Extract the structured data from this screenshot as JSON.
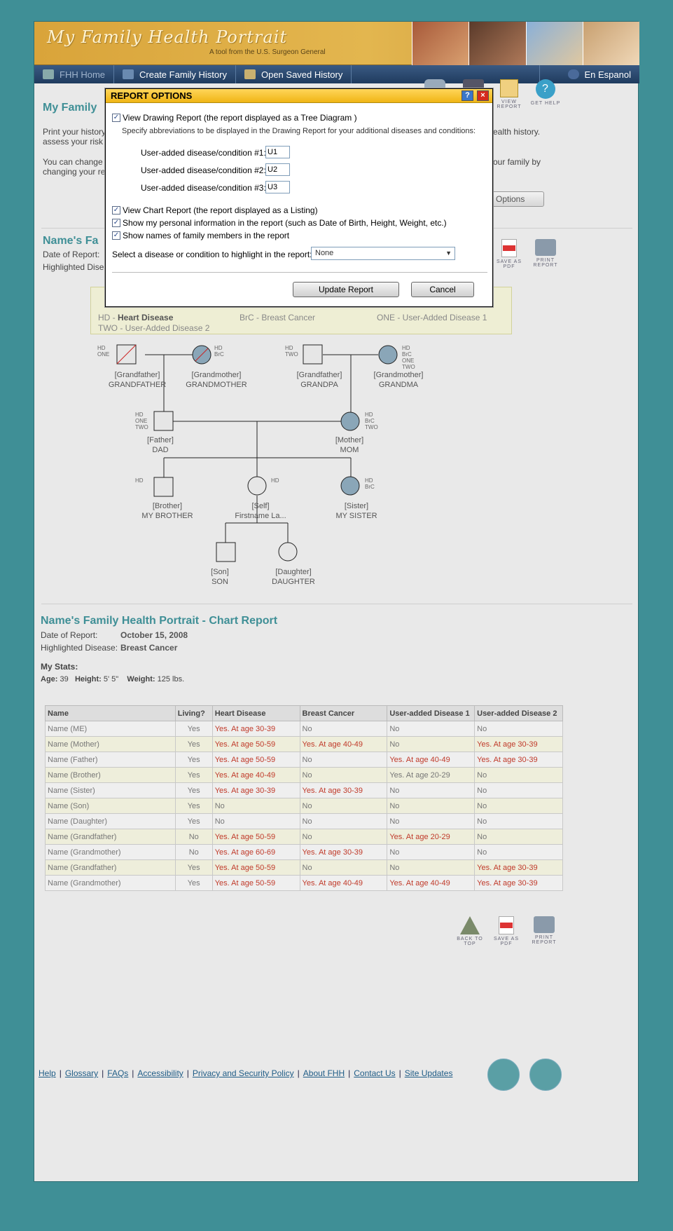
{
  "banner": {
    "title": "My Family Health Portrait",
    "subtitle": "A tool from the U.S. Surgeon General"
  },
  "nav": {
    "items": [
      {
        "label": "FHH Home",
        "icon": "home-icon"
      },
      {
        "label": "Create Family History",
        "icon": "plus-icon"
      },
      {
        "label": "Open Saved History",
        "icon": "folder-icon"
      }
    ],
    "language": "En Espanol"
  },
  "header_icons": {
    "view_report": "VIEW REPORT",
    "get_help": "GET HELP"
  },
  "intro": {
    "title_partial": "My Family",
    "line1": "Print your history",
    "line2": "assess your risk",
    "line1_right": "ealth history.",
    "line3": "You can change t",
    "line4": "changing your rep",
    "line3_right": "our family by",
    "options_btn": "Options"
  },
  "drawing": {
    "title_partial": "Name's Fa",
    "date_label": "Date of Report:",
    "highlight_label": "Highlighted Disea",
    "save_pdf": "SAVE AS PDF",
    "print": "PRINT REPORT",
    "legend": {
      "hd": "HD - ",
      "hd_name": "Heart Disease",
      "brc": "BrC - Breast Cancer",
      "one": "ONE - User-Added Disease 1",
      "two": "TWO - User-Added Disease 2"
    },
    "people": {
      "gf1": {
        "role": "[Grandfather]",
        "name": "GRANDFATHER",
        "codes": "HD\nONE"
      },
      "gm1": {
        "role": "[Grandmother]",
        "name": "GRANDMOTHER",
        "codes": "HD\nBrC"
      },
      "gf2": {
        "role": "[Grandfather]",
        "name": "GRANDPA",
        "codes": "HD\nTWO"
      },
      "gm2": {
        "role": "[Grandmother]",
        "name": "GRANDMA",
        "codes": "HD\nBrC\nONE\nTWO"
      },
      "father": {
        "role": "[Father]",
        "name": "DAD",
        "codes": "HD\nONE\nTWO"
      },
      "mother": {
        "role": "[Mother]",
        "name": "MOM",
        "codes": "HD\nBrC\nTWO"
      },
      "brother": {
        "role": "[Brother]",
        "name": "MY BROTHER",
        "codes": "HD"
      },
      "self": {
        "role": "[Self]",
        "name": "Firstname La...",
        "codes": "HD"
      },
      "sister": {
        "role": "[Sister]",
        "name": "MY SISTER",
        "codes": "HD\nBrC"
      },
      "son": {
        "role": "[Son]",
        "name": "SON"
      },
      "daughter": {
        "role": "[Daughter]",
        "name": "DAUGHTER"
      }
    }
  },
  "chart": {
    "title": "Name's Family Health Portrait - Chart Report",
    "date_label": "Date of Report:",
    "date_value": "October 15, 2008",
    "highlight_label": "Highlighted Disease:",
    "highlight_value": "Breast Cancer",
    "stats_label": "My Stats:",
    "age_label": "Age:",
    "age_value": "39",
    "height_label": "Height:",
    "height_value": "5' 5\"",
    "weight_label": "Weight:",
    "weight_value": "125 lbs.",
    "columns": [
      "Name",
      "Living?",
      "Heart Disease",
      "Breast Cancer",
      "User-added Disease 1",
      "User-added Disease 2"
    ],
    "rows": [
      [
        "Name (ME)",
        "Yes",
        "Yes. At age 30-39",
        "No",
        "No",
        "No"
      ],
      [
        "Name (Mother)",
        "Yes",
        "Yes. At age 50-59",
        "Yes. At age 40-49",
        "No",
        "Yes. At age 30-39"
      ],
      [
        "Name (Father)",
        "Yes",
        "Yes. At age 50-59",
        "No",
        "Yes. At age 40-49",
        "Yes. At age 30-39"
      ],
      [
        "Name (Brother)",
        "Yes",
        "Yes. At age 40-49",
        "No",
        "Yes. At age 20-29",
        "No"
      ],
      [
        "Name (Sister)",
        "Yes",
        "Yes. At age 30-39",
        "Yes. At age 30-39",
        "No",
        "No"
      ],
      [
        "Name (Son)",
        "Yes",
        "No",
        "No",
        "No",
        "No"
      ],
      [
        "Name (Daughter)",
        "Yes",
        "No",
        "No",
        "No",
        "No"
      ],
      [
        "Name (Grandfather)",
        "No",
        "Yes. At age 50-59",
        "No",
        "Yes. At age 20-29",
        "No"
      ],
      [
        "Name (Grandmother)",
        "No",
        "Yes. At age 60-69",
        "Yes. At age 30-39",
        "No",
        "No"
      ],
      [
        "Name (Grandfather)",
        "Yes",
        "Yes. At age 50-59",
        "No",
        "No",
        "Yes. At age 30-39"
      ],
      [
        "Name (Grandmother)",
        "Yes",
        "Yes. At age 50-59",
        "Yes. At age 40-49",
        "Yes. At age 40-49",
        "Yes. At age 30-39"
      ]
    ],
    "back_to_top": "BACK TO TOP",
    "save_pdf": "SAVE AS PDF",
    "print": "PRINT REPORT"
  },
  "footer": {
    "links": [
      "Help",
      "Glossary",
      "FAQs",
      "Accessibility",
      "Privacy and Security Policy",
      "About FHH",
      "Contact Us",
      "Site Updates"
    ]
  },
  "modal": {
    "title": "REPORT OPTIONS",
    "view_drawing": "View Drawing Report (the report displayed as a Tree Diagram )",
    "abbr_help": "Specify abbreviations to be displayed in the Drawing Report for your additional diseases and conditions:",
    "abbr1_label": "User-added disease/condition #1:",
    "abbr1_value": "U1",
    "abbr2_label": "User-added disease/condition #2:",
    "abbr2_value": "U2",
    "abbr3_label": "User-added disease/condition #3:",
    "abbr3_value": "U3",
    "view_chart": "View Chart Report (the report displayed as a Listing)",
    "show_personal": "Show my personal information in the report (such as Date of Birth, Height, Weight, etc.)",
    "show_names": "Show names of family members in the report",
    "highlight_label": "Select a disease or condition to highlight in the report:",
    "highlight_value": "None",
    "update_btn": "Update Report",
    "cancel_btn": "Cancel"
  },
  "colors": {
    "accent": "#3f8f96",
    "nav": "#1f3b5e",
    "modal_header": "#f0b515",
    "risk_text": "#c03a2a"
  }
}
